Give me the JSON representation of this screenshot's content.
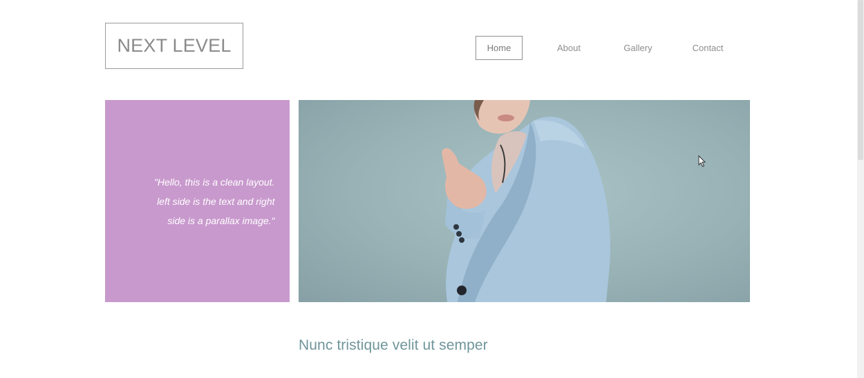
{
  "logo": {
    "text": "NEXT LEVEL"
  },
  "nav": {
    "items": [
      {
        "label": "Home",
        "active": true
      },
      {
        "label": "About",
        "active": false
      },
      {
        "label": "Gallery",
        "active": false
      },
      {
        "label": "Contact",
        "active": false
      }
    ]
  },
  "hero": {
    "quote_lines": [
      "\"Hello, this is a clean layout.",
      "left side is the text and right",
      "side is a parallax image.\""
    ],
    "quote_color": "#c899cd",
    "image": "woman-in-light-blue-blazer-pointing"
  },
  "section": {
    "heading": "Nunc tristique velit ut semper"
  },
  "colors": {
    "accent_purple": "#c899cd",
    "heading_teal": "#6f959a",
    "nav_text": "#8d8d8d"
  }
}
